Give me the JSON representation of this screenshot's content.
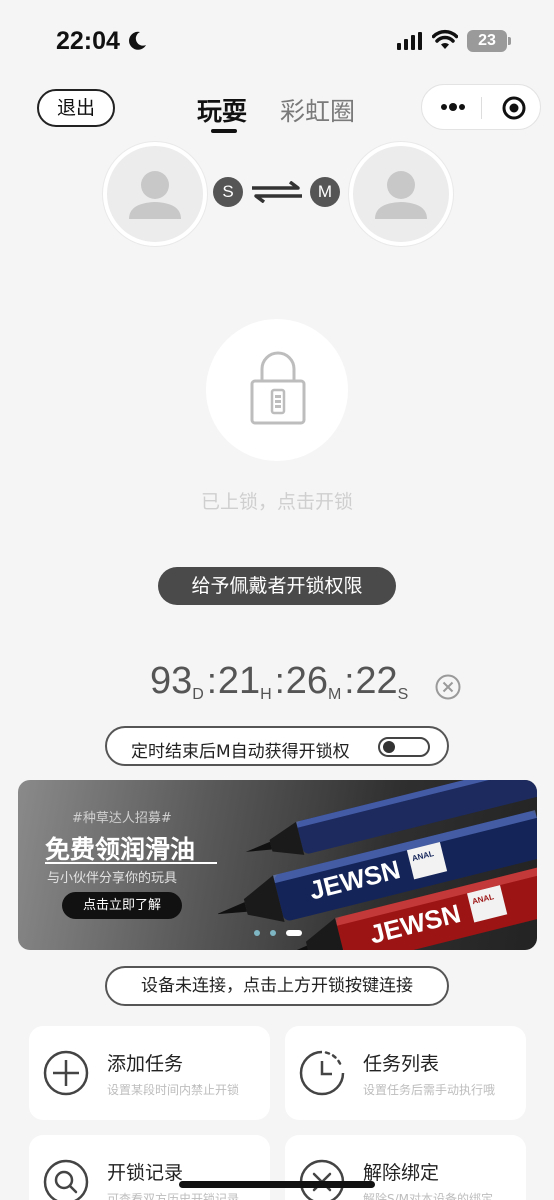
{
  "status_bar": {
    "time": "22:04",
    "battery": "23",
    "icons": [
      "moon-icon",
      "signal-icon",
      "wifi-icon",
      "battery-icon"
    ]
  },
  "header": {
    "exit_label": "退出",
    "tabs": [
      {
        "label": "玩耍",
        "active": true
      },
      {
        "label": "彩虹圈",
        "active": false
      }
    ],
    "capsule_icons": [
      "more-icon",
      "target-icon"
    ]
  },
  "pair": {
    "s_badge": "S",
    "m_badge": "M",
    "icons": [
      "avatar-icon",
      "swap-arrows-icon"
    ]
  },
  "lock": {
    "status_text": "已上锁，点击开锁",
    "icon": "lock-icon"
  },
  "grant_button": "给予佩戴者开锁权限",
  "countdown": {
    "days": "93",
    "days_unit": "D",
    "hours": "21",
    "hours_unit": "H",
    "minutes": "26",
    "minutes_unit": "M",
    "seconds": "22",
    "seconds_unit": "S"
  },
  "timer_toggle": {
    "label": "定时结束后M自动获得开锁权",
    "on": false
  },
  "banner": {
    "tag": "#种草达人招募#",
    "title": "免费领润滑油",
    "subtitle": "与小伙伴分享你的玩具",
    "button": "点击立即了解",
    "product_brand": "JEWSN",
    "product_label": "ANAL",
    "carousel": {
      "count": 3,
      "active": 3
    }
  },
  "connect_button": "设备未连接，点击上方开锁按键连接",
  "cards": [
    {
      "title": "添加任务",
      "subtitle": "设置某段时间内禁止开锁",
      "icon": "plus-circle-icon"
    },
    {
      "title": "任务列表",
      "subtitle": "设置任务后需手动执行哦",
      "icon": "clock-icon"
    },
    {
      "title": "开锁记录",
      "subtitle": "可查看双方历史开锁记录",
      "icon": "search-icon"
    },
    {
      "title": "解除绑定",
      "subtitle": "解除S/M对本设备的绑定",
      "icon": "unbind-icon"
    }
  ],
  "colors": {
    "background": "#f5f5f5",
    "dark_button": "#4a4a4a",
    "muted_text": "#cfcfcf"
  }
}
